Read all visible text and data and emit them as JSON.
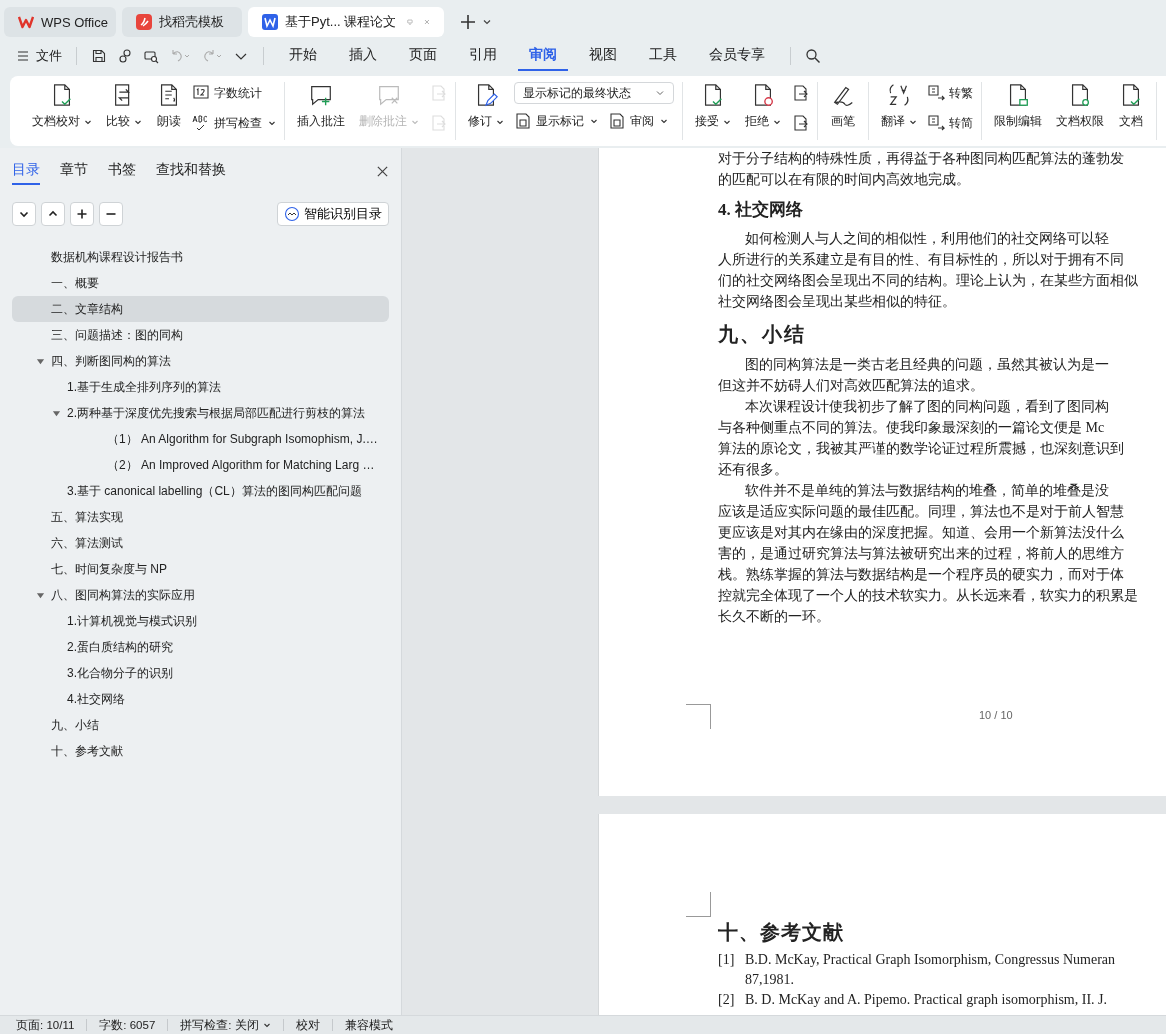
{
  "app_tabs": [
    {
      "label": "WPS Office",
      "kind": "home",
      "selected": false
    },
    {
      "label": "找稻壳模板",
      "kind": "template",
      "selected": false
    },
    {
      "label": "基于Pyt... 课程论文",
      "kind": "document",
      "selected": true
    }
  ],
  "menu": {
    "file_label": "文件",
    "tabs": [
      {
        "label": "开始",
        "selected": false
      },
      {
        "label": "插入",
        "selected": false
      },
      {
        "label": "页面",
        "selected": false
      },
      {
        "label": "引用",
        "selected": false
      },
      {
        "label": "审阅",
        "selected": true
      },
      {
        "label": "视图",
        "selected": false
      },
      {
        "label": "工具",
        "selected": false
      },
      {
        "label": "会员专享",
        "selected": false
      }
    ]
  },
  "ribbon": [
    {
      "columns": [
        {
          "kind": "large",
          "label": "文档校对",
          "caret": true,
          "disabled": false
        },
        {
          "kind": "large",
          "label": "比较",
          "caret": true,
          "disabled": false
        },
        {
          "kind": "large",
          "label": "朗读",
          "caret": false,
          "disabled": false
        },
        {
          "kind": "stack",
          "items": [
            {
              "kind": "text",
              "label": "字数统计",
              "caret": false,
              "disabled": false
            },
            {
              "kind": "text",
              "label": "拼写检查",
              "caret": true,
              "disabled": false
            }
          ]
        }
      ]
    },
    {
      "columns": [
        {
          "kind": "large",
          "label": "插入批注",
          "caret": false,
          "disabled": false
        },
        {
          "kind": "large",
          "label": "删除批注",
          "caret": true,
          "disabled": true
        },
        {
          "kind": "stack",
          "items": [
            {
              "kind": "icon",
              "disabled": true
            },
            {
              "kind": "icon",
              "disabled": true
            }
          ]
        }
      ]
    },
    {
      "columns": [
        {
          "kind": "large",
          "label": "修订",
          "caret": true,
          "disabled": false
        },
        {
          "kind": "select",
          "value": "显示标记的最终状态",
          "items": [
            {
              "kind": "text",
              "label": "显示标记",
              "caret": true,
              "disabled": false
            },
            {
              "kind": "text",
              "label": "审阅",
              "caret": true,
              "disabled": false
            }
          ]
        }
      ]
    },
    {
      "columns": [
        {
          "kind": "large",
          "label": "接受",
          "caret": true,
          "disabled": false
        },
        {
          "kind": "large",
          "label": "拒绝",
          "caret": true,
          "disabled": false
        },
        {
          "kind": "stack",
          "items": [
            {
              "kind": "icon",
              "disabled": false
            },
            {
              "kind": "icon",
              "disabled": false
            }
          ]
        }
      ]
    },
    {
      "columns": [
        {
          "kind": "large",
          "label": "画笔",
          "caret": false,
          "disabled": false
        }
      ]
    },
    {
      "columns": [
        {
          "kind": "large",
          "label": "翻译",
          "caret": true,
          "disabled": false
        },
        {
          "kind": "stack",
          "items": [
            {
              "kind": "text",
              "label": "转繁",
              "caret": false,
              "disabled": false
            },
            {
              "kind": "text",
              "label": "转简",
              "caret": false,
              "disabled": false
            }
          ]
        }
      ]
    },
    {
      "columns": [
        {
          "kind": "large",
          "label": "限制编辑",
          "caret": false,
          "disabled": false
        },
        {
          "kind": "large",
          "label": "文档权限",
          "caret": false,
          "disabled": false
        },
        {
          "kind": "large",
          "label": "文档",
          "caret": false,
          "disabled": false
        }
      ]
    }
  ],
  "nav_panel": {
    "tabs": [
      {
        "label": "目录",
        "selected": true
      },
      {
        "label": "章节",
        "selected": false
      },
      {
        "label": "书签",
        "selected": false
      },
      {
        "label": "查找和替换",
        "selected": false
      }
    ],
    "smart_button": "智能识别目录",
    "toc": [
      {
        "label": "数据机构课程设计报告书",
        "selected": false
      },
      {
        "label": "一、概要",
        "selected": false
      },
      {
        "label": "二、文章结构",
        "selected": true
      },
      {
        "label": "三、问题描述：图的同构",
        "selected": false
      },
      {
        "label": "四、判断图同构的算法",
        "selected": false,
        "expanded": true,
        "children": [
          {
            "label": "1.基于生成全排列序列的算法",
            "selected": false
          },
          {
            "label": "2.两种基于深度优先搜索与根据局部匹配进行剪枝的算法",
            "selected": false,
            "expanded": true,
            "children": [
              {
                "label": "（1）  An Algorithm for Subgraph Isomophism, J.…",
                "selected": false
              },
              {
                "label": "（2）  An Improved Algorithm for Matching Larg …",
                "selected": false
              }
            ]
          },
          {
            "label": "3.基于 canonical labelling（CL）算法的图同构匹配问题",
            "selected": false
          }
        ]
      },
      {
        "label": "五、算法实现",
        "selected": false
      },
      {
        "label": "六、算法测试",
        "selected": false
      },
      {
        "label": "七、时间复杂度与 NP",
        "selected": false
      },
      {
        "label": "八、图同构算法的实际应用",
        "selected": false,
        "expanded": true,
        "children": [
          {
            "label": "1.计算机视觉与模式识别",
            "selected": false
          },
          {
            "label": "2.蛋白质结构的研究",
            "selected": false
          },
          {
            "label": "3.化合物分子的识别",
            "selected": false
          },
          {
            "label": "4.社交网络",
            "selected": false
          }
        ]
      },
      {
        "label": "九、小结",
        "selected": false
      },
      {
        "label": "十、参考文献",
        "selected": false
      }
    ]
  },
  "document": {
    "page_1": [
      {
        "kind": "line",
        "text": "对于分子结构的特殊性质，再得益于各种图同构匹配算法的蓬勃发"
      },
      {
        "kind": "line",
        "text": "的匹配可以在有限的时间内高效地完成。"
      },
      {
        "kind": "heading",
        "text": "4. 社交网络"
      },
      {
        "kind": "first",
        "text": "如何检测人与人之间的相似性，利用他们的社交网络可以轻"
      },
      {
        "kind": "line",
        "text": "人所进行的关系建立是有目的性、有目标性的，所以对于拥有不同"
      },
      {
        "kind": "line",
        "text": "们的社交网络图会呈现出不同的结构。理论上认为，在某些方面相似"
      },
      {
        "kind": "line",
        "text": "社交网络图会呈现出某些相似的特征。"
      },
      {
        "kind": "title",
        "text": "九、小结"
      },
      {
        "kind": "first",
        "text": "图的同构算法是一类古老且经典的问题，虽然其被认为是一"
      },
      {
        "kind": "line",
        "text": "但这并不妨碍人们对高效匹配算法的追求。"
      },
      {
        "kind": "first",
        "text": "本次课程设计使我初步了解了图的同构问题，看到了图同构"
      },
      {
        "kind": "line",
        "text": "与各种侧重点不同的算法。使我印象最深刻的一篇论文便是 Mc"
      },
      {
        "kind": "line",
        "text": "算法的原论文，我被其严谨的数学论证过程所震撼，也深刻意识到"
      },
      {
        "kind": "line",
        "text": "还有很多。"
      },
      {
        "kind": "first",
        "text": "软件并不是单纯的算法与数据结构的堆叠，简单的堆叠是没"
      },
      {
        "kind": "line",
        "text": "应该是适应实际问题的最佳匹配。同理，算法也不是对于前人智慧"
      },
      {
        "kind": "line",
        "text": "更应该是对其内在缘由的深度把握。知道、会用一个新算法没什么"
      },
      {
        "kind": "line",
        "text": "害的，是通过研究算法与算法被研究出来的过程，将前人的思维方"
      },
      {
        "kind": "line",
        "text": "栈。熟练掌握的算法与数据结构是一个程序员的硬实力，而对于体"
      },
      {
        "kind": "line",
        "text": "控就完全体现了一个人的技术软实力。从长远来看，软实力的积累是"
      },
      {
        "kind": "line",
        "text": "长久不断的一环。"
      }
    ],
    "page_number": "10 / 10",
    "page_2_title": "十、参考文献",
    "references": [
      {
        "mark": "[1]",
        "lines": [
          "B.D. McKay, Practical Graph Isomorphism, Congressus Numeran",
          "87,1981."
        ]
      },
      {
        "mark": "[2]",
        "lines": [
          "B. D. McKay and A. Pipemo. Practical graph isomorphism, II. J."
        ]
      }
    ]
  },
  "status_bar": [
    {
      "label": "页面: 10/11",
      "caret": false
    },
    {
      "label": "字数: 6057",
      "caret": false
    },
    {
      "label": "拼写检查: 关闭",
      "caret": true
    },
    {
      "label": "校对",
      "caret": false
    },
    {
      "label": "兼容模式",
      "caret": false
    }
  ]
}
